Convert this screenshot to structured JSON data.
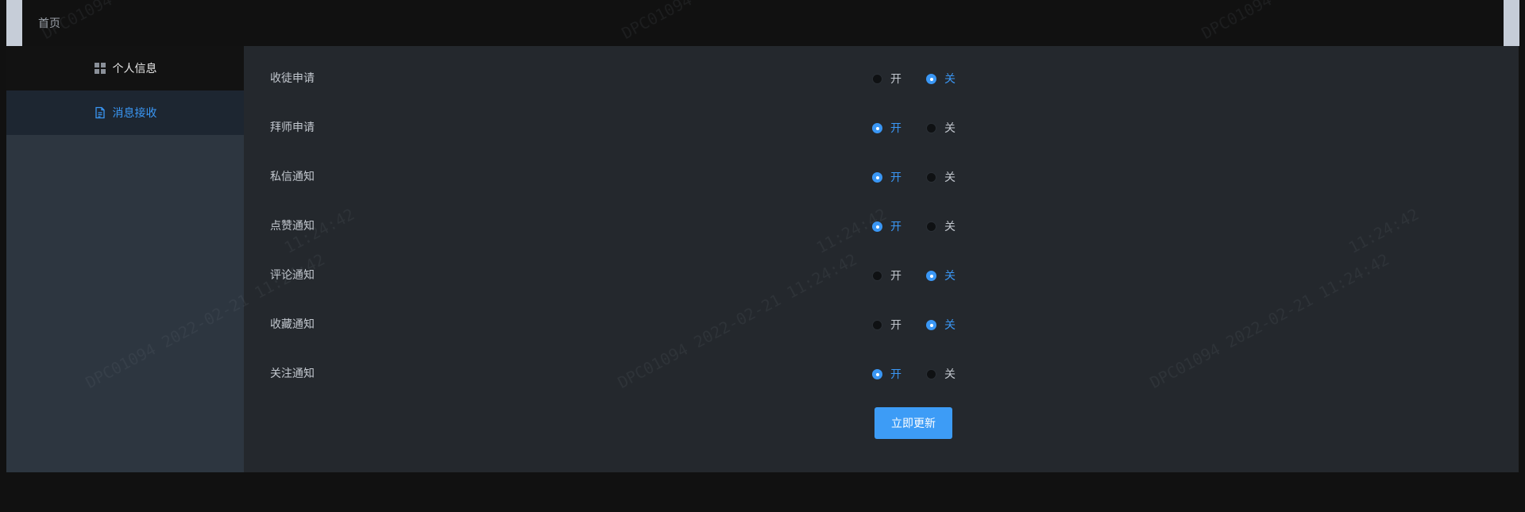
{
  "breadcrumb": "首页",
  "sidebar": {
    "items": [
      {
        "label": "个人信息",
        "icon": "grid-icon"
      },
      {
        "label": "消息接收",
        "icon": "document-icon"
      }
    ]
  },
  "colors": {
    "accent": "#3a97f5"
  },
  "settings": {
    "on_label": "开",
    "off_label": "关",
    "rows": [
      {
        "label": "收徒申请",
        "value": "off"
      },
      {
        "label": "拜师申请",
        "value": "on"
      },
      {
        "label": "私信通知",
        "value": "on"
      },
      {
        "label": "点赞通知",
        "value": "on"
      },
      {
        "label": "评论通知",
        "value": "off"
      },
      {
        "label": "收藏通知",
        "value": "off"
      },
      {
        "label": "关注通知",
        "value": "on"
      }
    ]
  },
  "update_button": "立即更新",
  "watermark": {
    "id": "DPC01094",
    "date": "2022-02-21",
    "time": "11:24:42"
  }
}
